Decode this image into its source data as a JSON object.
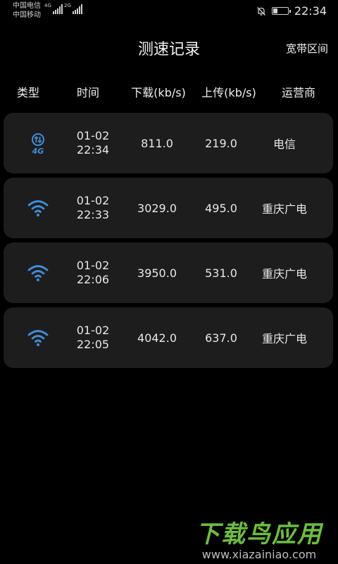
{
  "status": {
    "carrier1": "中国电信",
    "carrier2": "中国移动",
    "signal1_tag": "4G",
    "signal2_tag": "2G",
    "time": "22:34"
  },
  "header": {
    "title": "测速记录",
    "broadband_label": "宽带区间"
  },
  "columns": [
    "类型",
    "时间",
    "下载(kb/s)",
    "上传(kb/s)",
    "运营商"
  ],
  "records": [
    {
      "type_icon": "4g-icon",
      "date": "01-02",
      "time": "22:34",
      "download": "811.0",
      "upload": "219.0",
      "carrier": "电信"
    },
    {
      "type_icon": "wifi-icon",
      "date": "01-02",
      "time": "22:33",
      "download": "3029.0",
      "upload": "495.0",
      "carrier": "重庆广电"
    },
    {
      "type_icon": "wifi-icon",
      "date": "01-02",
      "time": "22:06",
      "download": "3950.0",
      "upload": "531.0",
      "carrier": "重庆广电"
    },
    {
      "type_icon": "wifi-icon",
      "date": "01-02",
      "time": "22:05",
      "download": "4042.0",
      "upload": "637.0",
      "carrier": "重庆广电"
    }
  ],
  "watermark": {
    "brand": "下载鸟应用",
    "url": "www.xiazainiao.com"
  },
  "colors": {
    "background": "#000000",
    "card": "#1d1d1d",
    "icon_blue": "#3d8fd9",
    "watermark_green": "#6bbf3a"
  }
}
